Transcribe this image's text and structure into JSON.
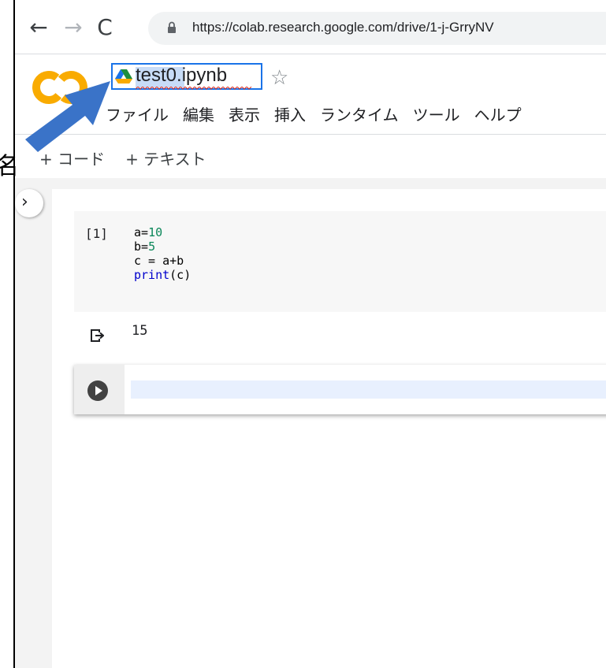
{
  "browser": {
    "url": "https://colab.research.google.com/drive/1-j-GrryNV"
  },
  "header": {
    "filename": "test0.ipynb",
    "menu": [
      "ファイル",
      "編集",
      "表示",
      "挿入",
      "ランタイム",
      "ツール",
      "ヘルプ"
    ]
  },
  "toolbar": {
    "add_code": "+ コード",
    "add_text": "+ テキスト"
  },
  "annotation": {
    "text": "名"
  },
  "cell1": {
    "execution_count": "[1]",
    "code": [
      "a=10",
      "b=5",
      "c = a+b",
      "print(c)"
    ],
    "output": "15"
  },
  "colors": {
    "accent": "#1a73e8",
    "arrow": "#3a73c8",
    "logo_orange": "#f9ab00"
  }
}
